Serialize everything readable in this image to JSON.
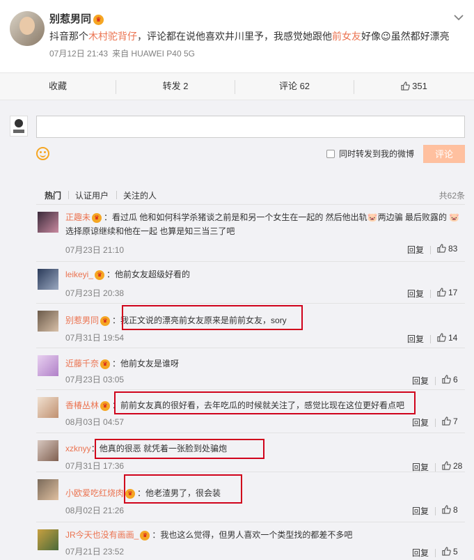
{
  "post": {
    "author": "别惹男同",
    "text_before": "抖音那个",
    "text_link1": "木村驼背仔",
    "text_mid": "，评论都在说他喜欢井川里予，我感觉她跟他",
    "text_link2": "前女友",
    "text_after": "好像😉虽然都好漂亮",
    "time": "07月12日 21:43",
    "source": "来自 HUAWEI P40 5G"
  },
  "actions": {
    "favorite": "收藏",
    "repost": "转发 2",
    "comment": "评论 62",
    "like": "351"
  },
  "composer": {
    "repost_label": "同时转发到我的微博",
    "submit": "评论"
  },
  "filter": {
    "hot": "热门",
    "verified": "认证用户",
    "following": "关注的人",
    "total": "共62条"
  },
  "colors": {
    "accent": "#eb7350",
    "highlight_box": "#d0021b",
    "submit_bg": "#ffc09f"
  },
  "comments": [
    {
      "user": "正趣未",
      "text": "：看过瓜 他和如何科学杀猪谈之前是和另一个女生在一起的 然后他出轨🐷两边骗 最后败露的 🐷选择原谅继续和他在一起 也算是知三当三了吧",
      "time": "07月23日 21:10",
      "reply": "回复",
      "likes": "83"
    },
    {
      "user": "leikeyi_",
      "text": "：他前女友超级好看的",
      "time": "07月23日 20:38",
      "reply": "回复",
      "likes": "17"
    },
    {
      "user": "别惹男同",
      "text": "：我正文说的漂亮前女友原来是前前女友，sory",
      "time": "07月31日 19:54",
      "reply": "回复",
      "likes": "14"
    },
    {
      "user": "近藤千奈",
      "text": "：他前女友是谁呀",
      "time": "07月23日 03:05",
      "reply": "回复",
      "likes": "6"
    },
    {
      "user": "香椿丛林",
      "text": "：前前女友真的很好看，去年吃瓜的时候就关注了，感觉比现在这位更好看点吧",
      "time": "08月03日 04:57",
      "reply": "回复",
      "likes": "7"
    },
    {
      "user": "xzknyy",
      "text": "：他真的很恶 就凭着一张脸到处骗炮",
      "time": "07月31日 17:36",
      "reply": "回复",
      "likes": "28"
    },
    {
      "user": "小欧爱吃红烧肉",
      "text": "：他老渣男了，很会装",
      "time": "08月02日 21:26",
      "reply": "回复",
      "likes": "8"
    },
    {
      "user": "JR今天也没有画画_",
      "text": "：我也这么觉得，但男人喜欢一个类型找的都差不多吧",
      "time": "07月21日 23:52",
      "reply": "回复",
      "likes": "5"
    }
  ]
}
